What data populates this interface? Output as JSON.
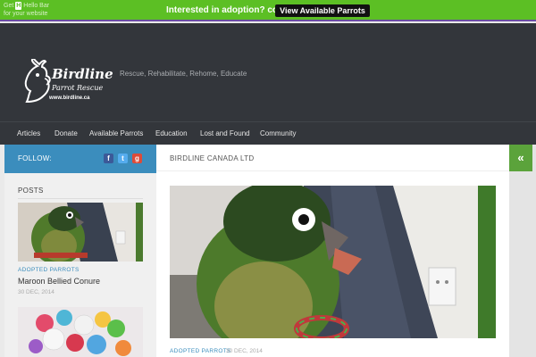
{
  "hello_bar": {
    "left_text": "Get Hello Bar for your website",
    "left_logo": "H",
    "left_line1": "Get",
    "left_line1b": "Hello Bar",
    "left_line2": "for your website",
    "message": "Interested in adoption? copy",
    "button_label": "View Available Parrots",
    "bar_color": "#5cbf24"
  },
  "header": {
    "logo_title": "Birdline",
    "logo_subtitle": "Parrot Rescue",
    "logo_url": "www.birdline.ca",
    "tagline": "Rescue, Rehabilitate, Rehome, Educate"
  },
  "nav": {
    "items": [
      "Articles",
      "Donate",
      "Available Parrots",
      "Education",
      "Lost and Found",
      "Community"
    ]
  },
  "sidebar": {
    "follow_label": "FOLLOW:",
    "social_icons": [
      "facebook-icon",
      "twitter-icon",
      "google-plus-icon"
    ],
    "posts_title": "POSTS",
    "posts": [
      {
        "category": "ADOPTED PARROTS",
        "title": "Maroon Bellied Conure",
        "date": "30 DEC, 2014"
      }
    ]
  },
  "main": {
    "title": "BIRDLINE CANADA LTD",
    "category": "ADOPTED PARROTS",
    "date": "30 DEC, 2014"
  },
  "colors": {
    "accent_blue": "#3b8dbd",
    "accent_green": "#5ba33b",
    "header_bg": "#33363b"
  }
}
